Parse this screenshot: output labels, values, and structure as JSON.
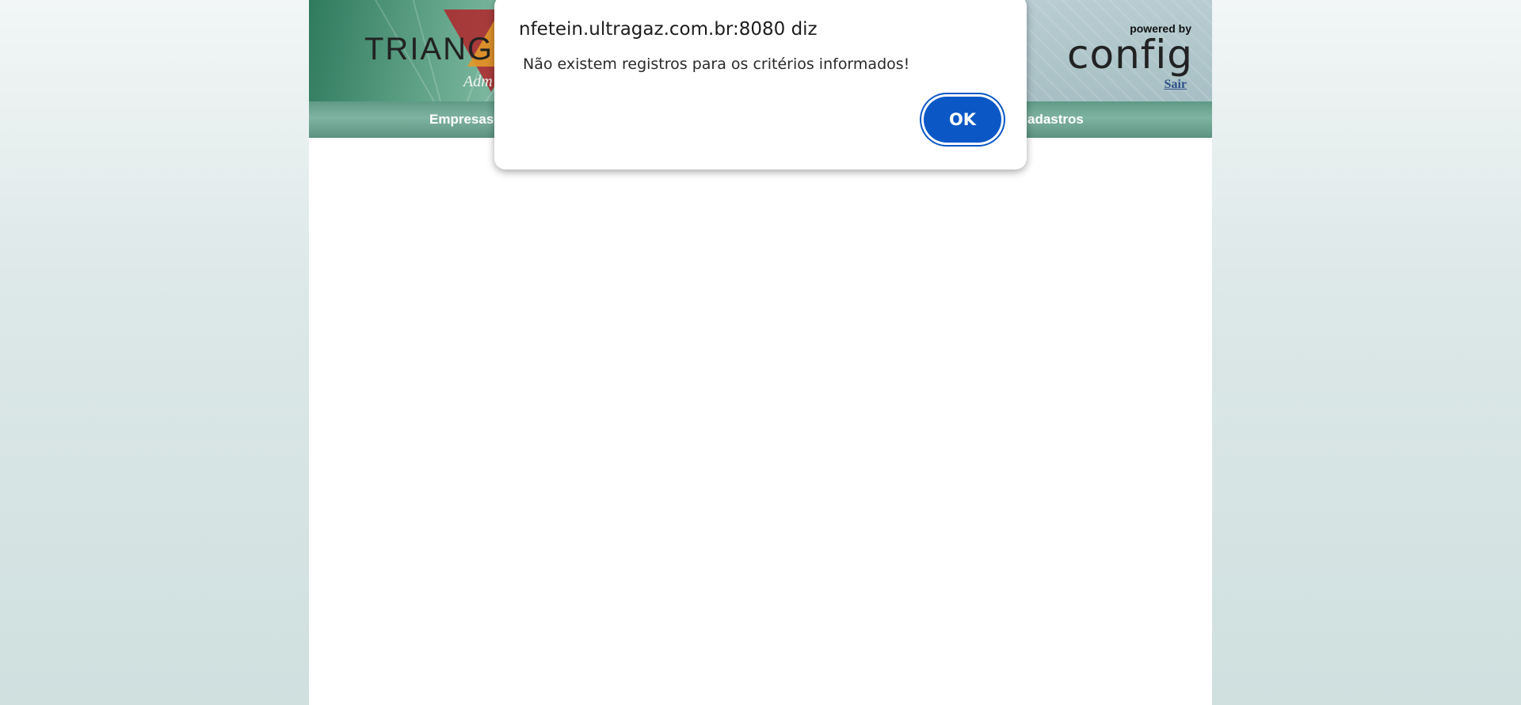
{
  "header": {
    "logo_text": "TRIANGU",
    "logo_subtitle": "Adm",
    "powered_by": "powered by",
    "config_brand": "config",
    "logout_link": "Sair"
  },
  "nav": {
    "items": [
      "Empresas",
      "adastros"
    ]
  },
  "alert": {
    "title": "nfetein.ultragaz.com.br:8080 diz",
    "message": "Não existem registros para os critérios informados!",
    "ok_label": "OK",
    "button_color": "#0b57c6"
  },
  "colors": {
    "header_green": "#2f7a5e",
    "navbar_green": "#6fa892",
    "logo_red": "#b0262a",
    "logo_orange": "#e19a2a",
    "link_blue": "#2d4f8a"
  }
}
